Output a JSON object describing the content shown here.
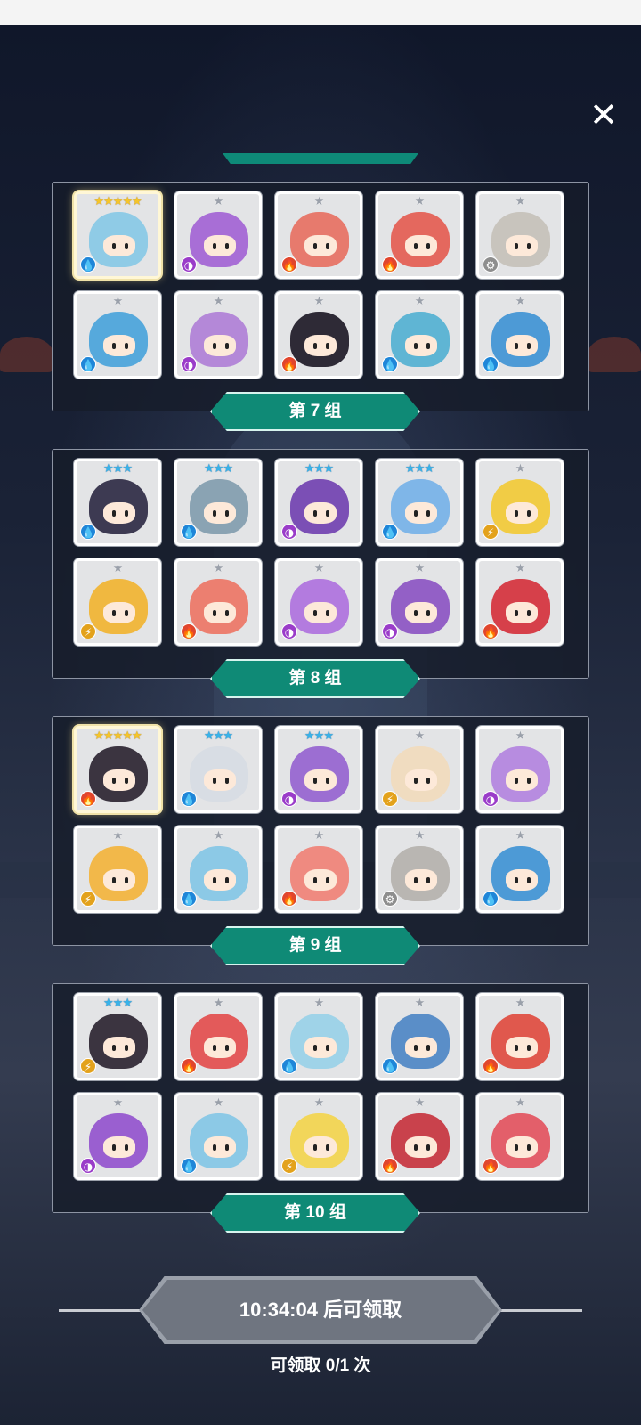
{
  "close_label": "✕",
  "groups": [
    {
      "label": "第 7 组",
      "cards": [
        {
          "stars": "★★★★★",
          "tier": 5,
          "element": "water",
          "icon": "💧",
          "color": "#8fcbe6"
        },
        {
          "stars": "★",
          "tier": 1,
          "element": "dark",
          "icon": "◑",
          "color": "#a86ed6"
        },
        {
          "stars": "★",
          "tier": 1,
          "element": "fire",
          "icon": "🔥",
          "color": "#e77a6d"
        },
        {
          "stars": "★",
          "tier": 1,
          "element": "fire",
          "icon": "🔥",
          "color": "#e4685e"
        },
        {
          "stars": "★",
          "tier": 1,
          "element": "gear",
          "icon": "⚙",
          "color": "#c8c4bd"
        },
        {
          "stars": "★",
          "tier": 1,
          "element": "water",
          "icon": "💧",
          "color": "#56a9dc"
        },
        {
          "stars": "★",
          "tier": 1,
          "element": "dark",
          "icon": "◑",
          "color": "#b488d8"
        },
        {
          "stars": "★",
          "tier": 1,
          "element": "fire",
          "icon": "🔥",
          "color": "#2e2a36"
        },
        {
          "stars": "★",
          "tier": 1,
          "element": "water",
          "icon": "💧",
          "color": "#5fb5d4"
        },
        {
          "stars": "★",
          "tier": 1,
          "element": "water",
          "icon": "💧",
          "color": "#4d9ad6"
        }
      ]
    },
    {
      "label": "第 8 组",
      "cards": [
        {
          "stars": "★★★",
          "tier": 3,
          "element": "water",
          "icon": "💧",
          "color": "#3d3a52"
        },
        {
          "stars": "★★★",
          "tier": 3,
          "element": "water",
          "icon": "💧",
          "color": "#8aa3b3"
        },
        {
          "stars": "★★★",
          "tier": 3,
          "element": "dark",
          "icon": "◑",
          "color": "#7b4fb5"
        },
        {
          "stars": "★★★",
          "tier": 3,
          "element": "water",
          "icon": "💧",
          "color": "#7fb6e8"
        },
        {
          "stars": "★",
          "tier": 1,
          "element": "light",
          "icon": "⚡",
          "color": "#f1cc45"
        },
        {
          "stars": "★",
          "tier": 1,
          "element": "light",
          "icon": "⚡",
          "color": "#f0b840"
        },
        {
          "stars": "★",
          "tier": 1,
          "element": "fire",
          "icon": "🔥",
          "color": "#ec7f70"
        },
        {
          "stars": "★",
          "tier": 1,
          "element": "dark",
          "icon": "◑",
          "color": "#b37bdf"
        },
        {
          "stars": "★",
          "tier": 1,
          "element": "dark",
          "icon": "◑",
          "color": "#9360c6"
        },
        {
          "stars": "★",
          "tier": 1,
          "element": "fire",
          "icon": "🔥",
          "color": "#d6404a"
        }
      ]
    },
    {
      "label": "第 9 组",
      "cards": [
        {
          "stars": "★★★★★",
          "tier": 5,
          "element": "fire",
          "icon": "🔥",
          "color": "#3b3440"
        },
        {
          "stars": "★★★",
          "tier": 3,
          "element": "water",
          "icon": "💧",
          "color": "#d8dde4"
        },
        {
          "stars": "★★★",
          "tier": 3,
          "element": "dark",
          "icon": "◑",
          "color": "#9c6ed2"
        },
        {
          "stars": "★",
          "tier": 1,
          "element": "light",
          "icon": "⚡",
          "color": "#f0dcc0"
        },
        {
          "stars": "★",
          "tier": 1,
          "element": "dark",
          "icon": "◑",
          "color": "#b78ce0"
        },
        {
          "stars": "★",
          "tier": 1,
          "element": "light",
          "icon": "⚡",
          "color": "#f2b84a"
        },
        {
          "stars": "★",
          "tier": 1,
          "element": "water",
          "icon": "💧",
          "color": "#8cc9e6"
        },
        {
          "stars": "★",
          "tier": 1,
          "element": "fire",
          "icon": "🔥",
          "color": "#ef8a80"
        },
        {
          "stars": "★",
          "tier": 1,
          "element": "gear",
          "icon": "⚙",
          "color": "#b9b6b2"
        },
        {
          "stars": "★",
          "tier": 1,
          "element": "water",
          "icon": "💧",
          "color": "#4d9ad6"
        }
      ]
    },
    {
      "label": "第 10 组",
      "cards": [
        {
          "stars": "★★★",
          "tier": 3,
          "element": "light",
          "icon": "⚡",
          "color": "#3b3440"
        },
        {
          "stars": "★",
          "tier": 1,
          "element": "fire",
          "icon": "🔥",
          "color": "#e35a5a"
        },
        {
          "stars": "★",
          "tier": 1,
          "element": "water",
          "icon": "💧",
          "color": "#9fd3e8"
        },
        {
          "stars": "★",
          "tier": 1,
          "element": "water",
          "icon": "💧",
          "color": "#5a8ec8"
        },
        {
          "stars": "★",
          "tier": 1,
          "element": "fire",
          "icon": "🔥",
          "color": "#e0584d"
        },
        {
          "stars": "★",
          "tier": 1,
          "element": "dark",
          "icon": "◑",
          "color": "#9a5fd0"
        },
        {
          "stars": "★",
          "tier": 1,
          "element": "water",
          "icon": "💧",
          "color": "#8cc9e6"
        },
        {
          "stars": "★",
          "tier": 1,
          "element": "light",
          "icon": "⚡",
          "color": "#f2d65a"
        },
        {
          "stars": "★",
          "tier": 1,
          "element": "fire",
          "icon": "🔥",
          "color": "#c9424c"
        },
        {
          "stars": "★",
          "tier": 1,
          "element": "fire",
          "icon": "🔥",
          "color": "#e35f6a"
        }
      ]
    }
  ],
  "claim": {
    "button_label": "10:34:04 后可领取",
    "count_label": "可领取 0/1 次"
  }
}
